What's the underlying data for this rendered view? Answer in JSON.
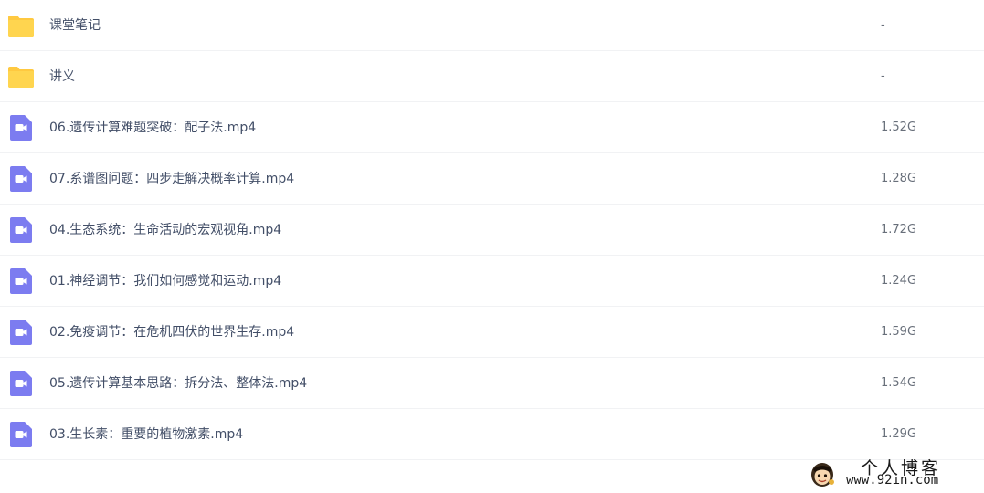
{
  "files": [
    {
      "type": "folder",
      "icon": "folder-icon",
      "name": "课堂笔记",
      "size": "-"
    },
    {
      "type": "folder",
      "icon": "folder-icon",
      "name": "讲义",
      "size": "-"
    },
    {
      "type": "video",
      "icon": "video-icon",
      "name": "06.遗传计算难题突破：配子法.mp4",
      "size": "1.52G"
    },
    {
      "type": "video",
      "icon": "video-icon",
      "name": "07.系谱图问题：四步走解决概率计算.mp4",
      "size": "1.28G"
    },
    {
      "type": "video",
      "icon": "video-icon",
      "name": "04.生态系统：生命活动的宏观视角.mp4",
      "size": "1.72G"
    },
    {
      "type": "video",
      "icon": "video-icon",
      "name": "01.神经调节：我们如何感觉和运动.mp4",
      "size": "1.24G"
    },
    {
      "type": "video",
      "icon": "video-icon",
      "name": "02.免疫调节：在危机四伏的世界生存.mp4",
      "size": "1.59G"
    },
    {
      "type": "video",
      "icon": "video-icon",
      "name": "05.遗传计算基本思路：拆分法、整体法.mp4",
      "size": "1.54G"
    },
    {
      "type": "video",
      "icon": "video-icon",
      "name": "03.生长素：重要的植物激素.mp4",
      "size": "1.29G"
    }
  ],
  "colors": {
    "folder": "#ffd54f",
    "video": "#7c7cf0",
    "row_border": "#f1f2f4",
    "name_text": "#424e67",
    "size_text": "#686f7a"
  },
  "watermark": {
    "title": "个人博客",
    "url": "www.92in.com",
    "icon": "cartoon-face-logo"
  }
}
